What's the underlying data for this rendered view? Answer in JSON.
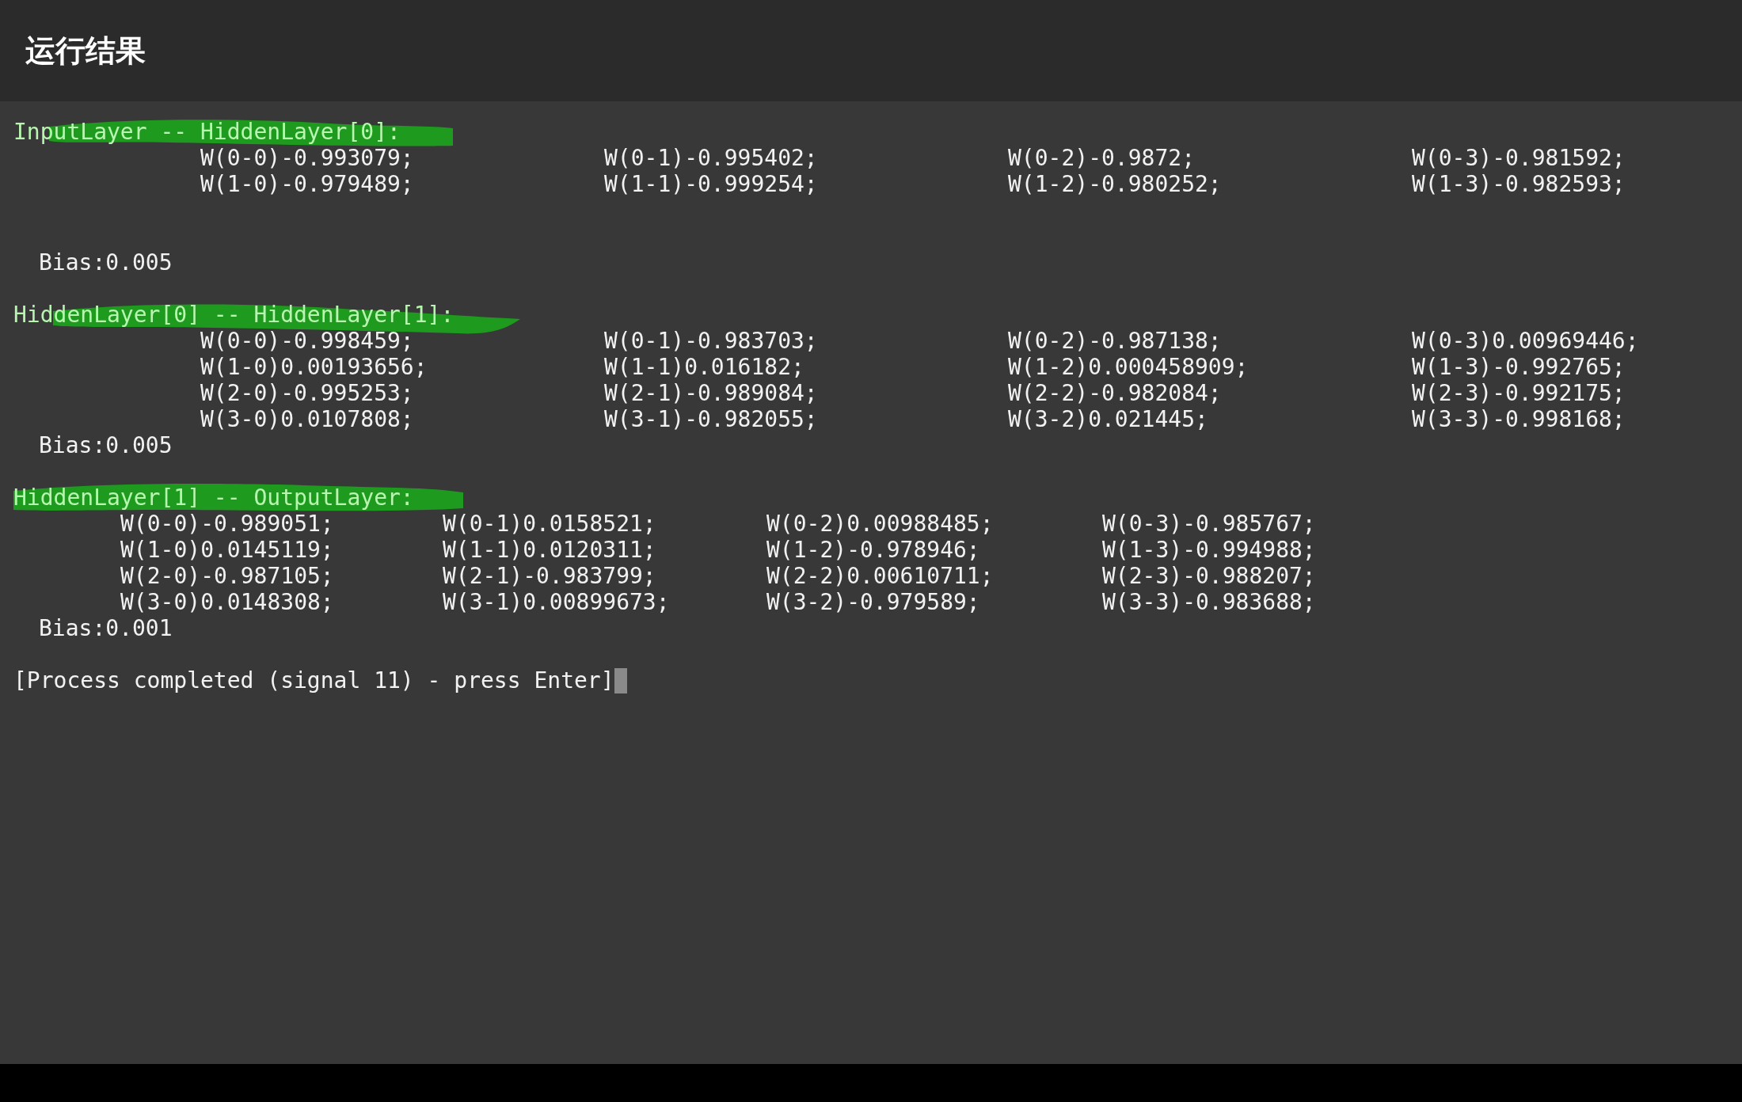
{
  "title": "运行结果",
  "sections": [
    {
      "header": "InputLayer -- HiddenLayer[0]:",
      "highlighted": true,
      "rows": [
        [
          "W(0-0)-0.993079;",
          "W(0-1)-0.995402;",
          "W(0-2)-0.9872;",
          "W(0-3)-0.981592;"
        ],
        [
          "W(1-0)-0.979489;",
          "W(1-1)-0.999254;",
          "W(1-2)-0.980252;",
          "W(1-3)-0.982593;"
        ]
      ],
      "bias": "Bias:0.005"
    },
    {
      "header": "HiddenLayer[0] -- HiddenLayer[1]:",
      "highlighted": true,
      "rows": [
        [
          "W(0-0)-0.998459;",
          "W(0-1)-0.983703;",
          "W(0-2)-0.987138;",
          "W(0-3)0.00969446;"
        ],
        [
          "W(1-0)0.00193656;",
          "W(1-1)0.016182;",
          "W(1-2)0.000458909;",
          "W(1-3)-0.992765;"
        ],
        [
          "W(2-0)-0.995253;",
          "W(2-1)-0.989084;",
          "W(2-2)-0.982084;",
          "W(2-3)-0.992175;"
        ],
        [
          "W(3-0)0.0107808;",
          "W(3-1)-0.982055;",
          "W(3-2)0.021445;",
          "W(3-3)-0.998168;"
        ]
      ],
      "bias": "Bias:0.005"
    },
    {
      "header": "HiddenLayer[1] -- OutputLayer:",
      "highlighted": true,
      "rows": [
        [
          "W(0-0)-0.989051;",
          "W(0-1)0.0158521;",
          "W(0-2)0.00988485;",
          "W(0-3)-0.985767;"
        ],
        [
          "W(1-0)0.0145119;",
          "W(1-1)0.0120311;",
          "W(1-2)-0.978946;",
          "W(1-3)-0.994988;"
        ],
        [
          "W(2-0)-0.987105;",
          "W(2-1)-0.983799;",
          "W(2-2)0.00610711;",
          "W(2-3)-0.988207;"
        ],
        [
          "W(3-0)0.0148308;",
          "W(3-1)0.00899673;",
          "W(3-2)-0.979589;",
          "W(3-3)-0.983688;"
        ]
      ],
      "bias": "Bias:0.001"
    }
  ],
  "footer": "[Process completed (signal 11) - press Enter]"
}
